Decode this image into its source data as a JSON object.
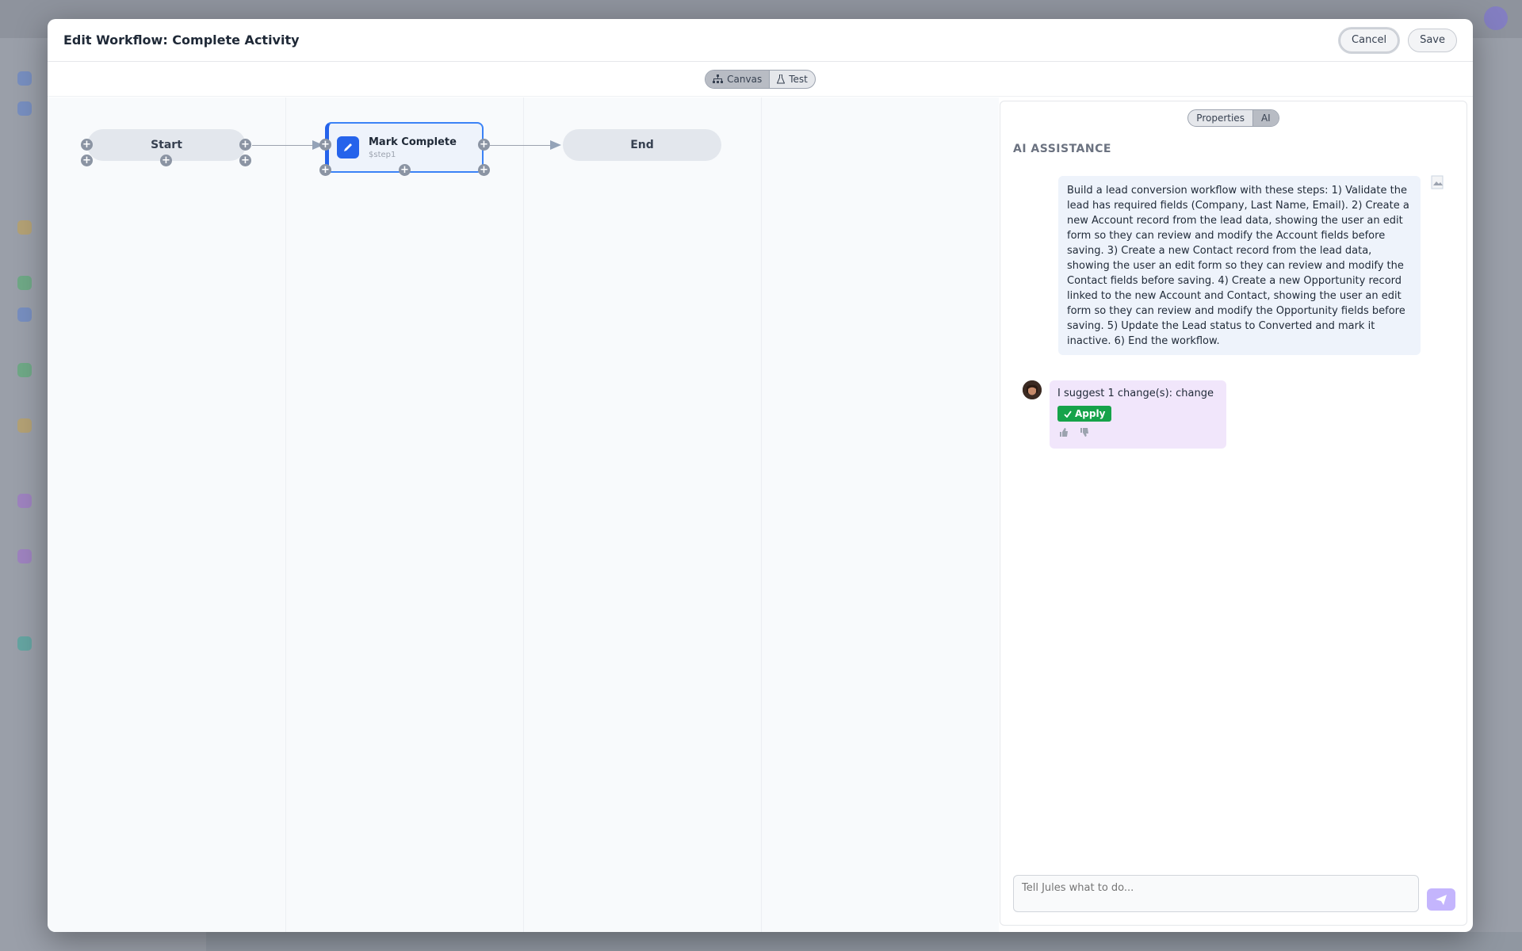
{
  "modal": {
    "title": "Edit Workflow: Complete Activity",
    "cancel_label": "Cancel",
    "save_label": "Save"
  },
  "view_toggle": {
    "canvas_label": "Canvas",
    "test_label": "Test",
    "active": "Canvas"
  },
  "nodes": {
    "start": "Start",
    "step": {
      "title": "Mark Complete",
      "subtitle": "$step1",
      "icon": "pencil-icon"
    },
    "end": "End"
  },
  "panel": {
    "properties_label": "Properties",
    "ai_label": "AI",
    "active": "AI",
    "section_label": "AI ASSISTANCE",
    "user_message": "Build a lead conversion workflow with these steps: 1) Validate the lead has required fields (Company, Last Name, Email). 2) Create a new Account record from the lead data, showing the user an edit form so they can review and modify the Account fields before saving. 3) Create a new Contact record from the lead data, showing the user an edit form so they can review and modify the Contact fields before saving. 4) Create a new Opportunity record linked to the new Account and Contact, showing the user an edit form so they can review and modify the Opportunity fields before saving. 5) Update the Lead status to Converted and mark it inactive. 6) End the workflow.",
    "ai_message": "I suggest 1 change(s): change",
    "apply_label": "Apply",
    "composer_placeholder": "Tell Jules what to do..."
  },
  "colors": {
    "accent": "#2563eb",
    "apply": "#16a34a",
    "ai_bubble": "#f1e6fb",
    "user_bubble": "#eef3fb",
    "send": "#c4b5fd"
  }
}
